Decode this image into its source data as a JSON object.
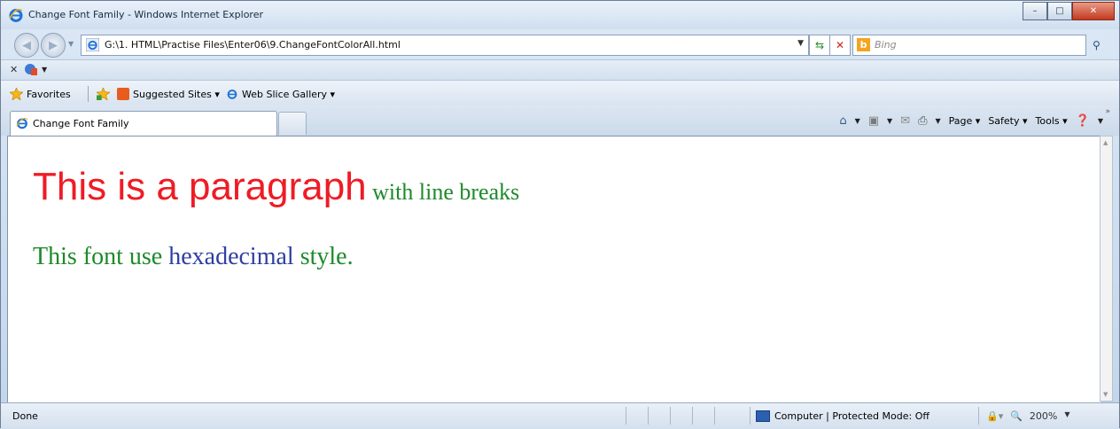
{
  "window": {
    "title": "Change Font Family - Windows Internet Explorer",
    "controls": {
      "minimize": "–",
      "maximize": "□",
      "close": "✕"
    }
  },
  "address": {
    "url": "G:\\1. HTML\\Practise Files\\Enter06\\9.ChangeFontColorAll.html",
    "search_placeholder": "Bing"
  },
  "command": {
    "close": "✕"
  },
  "favorites": {
    "favorites_label": "Favorites",
    "suggested_label": "Suggested Sites ▾",
    "webslice_label": "Web Slice Gallery ▾"
  },
  "tab": {
    "label": "Change Font Family"
  },
  "toolbar": {
    "page_label": "Page ▾",
    "safety_label": "Safety ▾",
    "tools_label": "Tools ▾"
  },
  "content": {
    "line1_big": "This is a paragraph",
    "line1_small": " with line breaks",
    "line2_start": "This font use ",
    "line2_hex": "hexadecimal",
    "line2_end": " style."
  },
  "status": {
    "text": "Done",
    "zone": "Computer | Protected Mode: Off",
    "zoom": "200%"
  },
  "colors": {
    "red_text": "#ee1c25",
    "green_text": "#1d8a2a",
    "blue_text": "#2f3fa0"
  }
}
